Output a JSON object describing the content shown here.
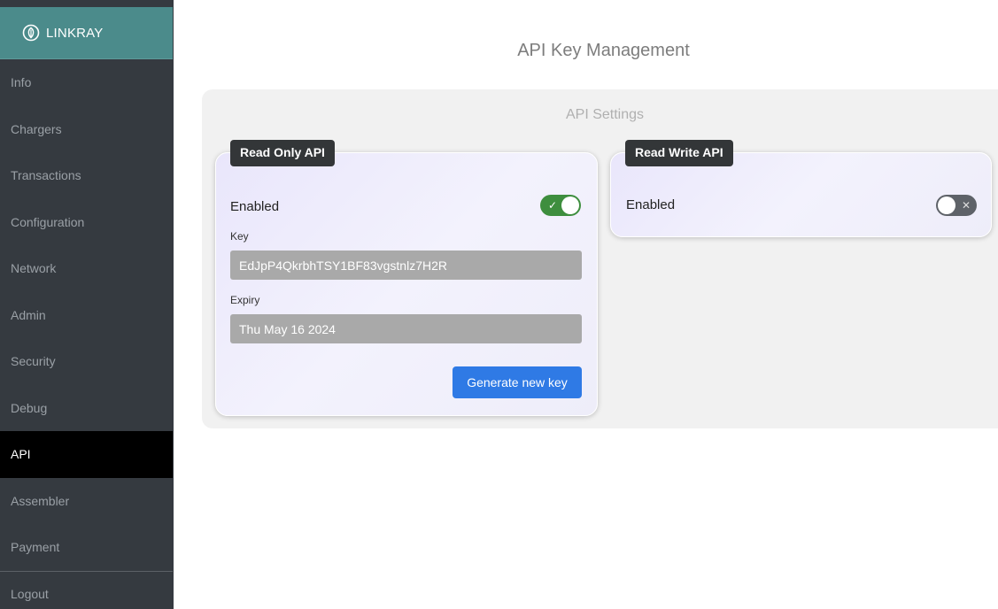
{
  "brand": {
    "name": "LINKRAY",
    "color": "#4b8b8b"
  },
  "sidebar": {
    "items": [
      {
        "label": "Info",
        "active": false
      },
      {
        "label": "Chargers",
        "active": false
      },
      {
        "label": "Transactions",
        "active": false
      },
      {
        "label": "Configuration",
        "active": false
      },
      {
        "label": "Network",
        "active": false
      },
      {
        "label": "Admin",
        "active": false
      },
      {
        "label": "Security",
        "active": false
      },
      {
        "label": "Debug",
        "active": false
      },
      {
        "label": "API",
        "active": true
      },
      {
        "label": "Assembler",
        "active": false
      },
      {
        "label": "Payment",
        "active": false
      }
    ],
    "logout_label": "Logout"
  },
  "page": {
    "title": "API Key Management"
  },
  "settings": {
    "title": "API Settings",
    "read_only": {
      "tag": "Read Only API",
      "enabled_label": "Enabled",
      "enabled": true,
      "toggle_icon": "check-icon",
      "toggle_glyph": "✓",
      "key_label": "Key",
      "key_value": "EdJpP4QkrbhTSY1BF83vgstnlz7H2R",
      "expiry_label": "Expiry",
      "expiry_value": "Thu May 16 2024",
      "generate_button": "Generate new key"
    },
    "read_write": {
      "tag": "Read Write API",
      "enabled_label": "Enabled",
      "enabled": false,
      "toggle_icon": "x-icon",
      "toggle_glyph": "✕"
    }
  },
  "colors": {
    "sidebar_bg": "#353a40",
    "active_item_bg": "#000000",
    "toggle_on": "#3e8e3e",
    "toggle_off": "#5e6268",
    "button": "#2f7ae5",
    "field_bg": "#a9a9a9"
  }
}
